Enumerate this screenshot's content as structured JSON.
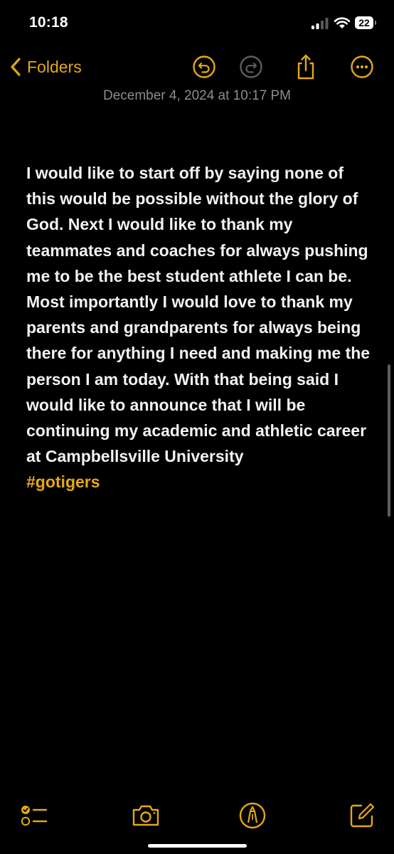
{
  "status_bar": {
    "time": "10:18",
    "battery": "22"
  },
  "nav": {
    "back_label": "Folders",
    "icons": [
      "chevron-left-icon",
      "undo-icon",
      "redo-icon",
      "share-icon",
      "more-icon"
    ]
  },
  "note": {
    "date": "December 4, 2024 at 10:17 PM",
    "body": "I would like to start off by saying none of this would be possible without the glory of God. Next I would like to thank my teammates and coaches for always pushing me to be the best student athlete I can be. Most importantly I would love to thank my parents and grandparents for always being there for anything I need and making me the person I am today. With that being said I would like to announce that I will be continuing my academic and athletic career at Campbellsville University",
    "hashtag": "#gotigers"
  },
  "toolbar": {
    "icons": [
      "checklist-icon",
      "camera-icon",
      "markup-icon",
      "compose-icon"
    ]
  },
  "colors": {
    "accent": "#e3a814",
    "background": "#000000",
    "text": "#f2f2f2",
    "secondary_text": "#8c8c8e"
  }
}
